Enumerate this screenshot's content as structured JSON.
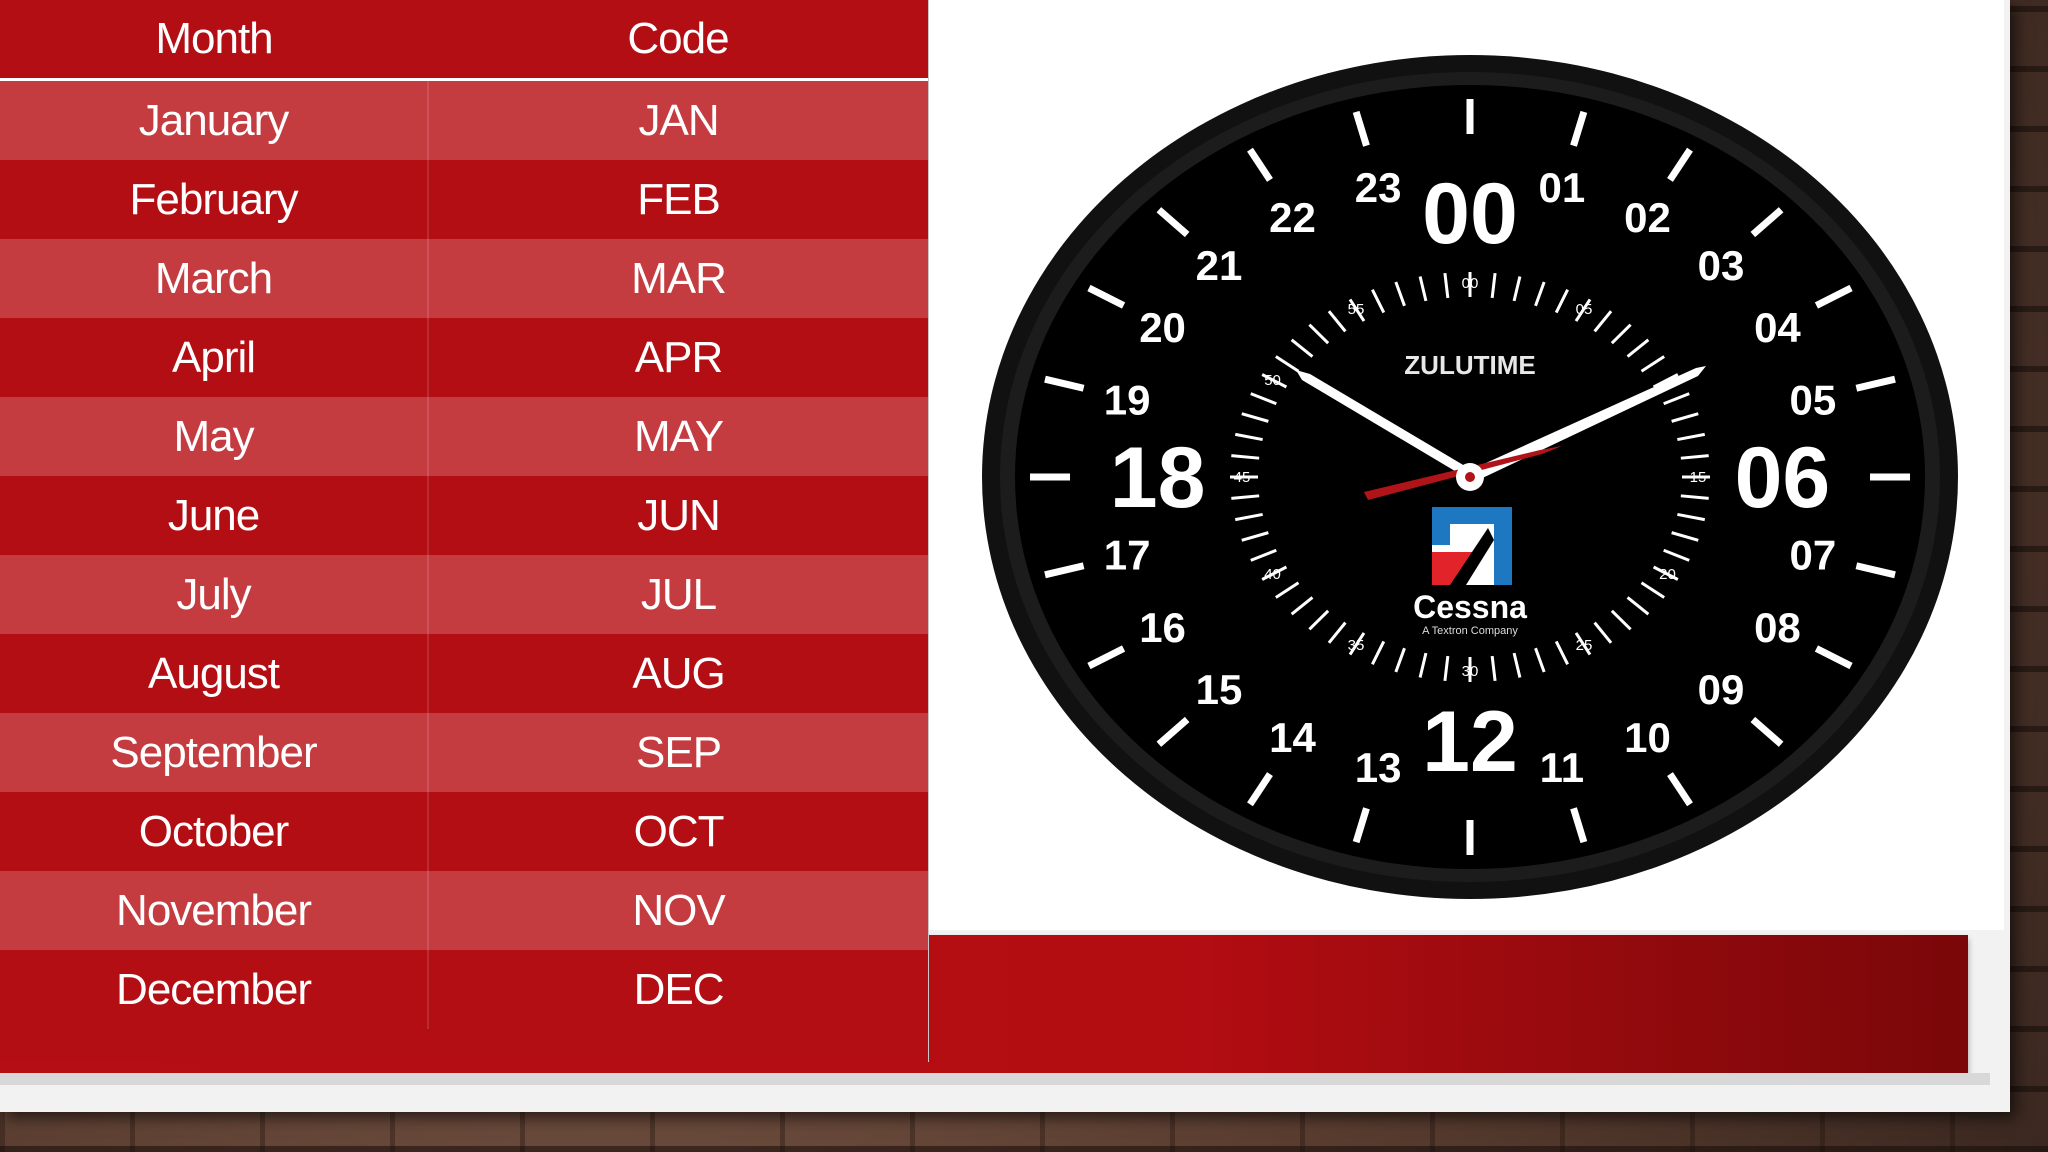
{
  "table": {
    "headers": {
      "month": "Month",
      "code": "Code"
    },
    "rows": [
      {
        "month": "January",
        "code": "JAN"
      },
      {
        "month": "February",
        "code": "FEB"
      },
      {
        "month": "March",
        "code": "MAR"
      },
      {
        "month": "April",
        "code": "APR"
      },
      {
        "month": "May",
        "code": "MAY"
      },
      {
        "month": "June",
        "code": "JUN"
      },
      {
        "month": "July",
        "code": "JUL"
      },
      {
        "month": "August",
        "code": "AUG"
      },
      {
        "month": "September",
        "code": "SEP"
      },
      {
        "month": "October",
        "code": "OCT"
      },
      {
        "month": "November",
        "code": "NOV"
      },
      {
        "month": "December",
        "code": "DEC"
      }
    ]
  },
  "clock": {
    "hour_labels": [
      "00",
      "01",
      "02",
      "03",
      "04",
      "05",
      "06",
      "07",
      "08",
      "09",
      "10",
      "11",
      "12",
      "13",
      "14",
      "15",
      "16",
      "17",
      "18",
      "19",
      "20",
      "21",
      "22",
      "23"
    ],
    "minute_labels": [
      "00",
      "05",
      "15",
      "20",
      "25",
      "30",
      "35",
      "40",
      "45",
      "50",
      "55"
    ],
    "brand_text": "ZULUTIME",
    "logo_name": "Cessna",
    "logo_tagline": "A Textron Company"
  },
  "colors": {
    "table_red": "#b20e13",
    "table_red_light": "#c43c40",
    "clock_face": "#000000",
    "second_hand": "#b01418",
    "logo_blue": "#1d78c1",
    "logo_red": "#e2232a"
  }
}
